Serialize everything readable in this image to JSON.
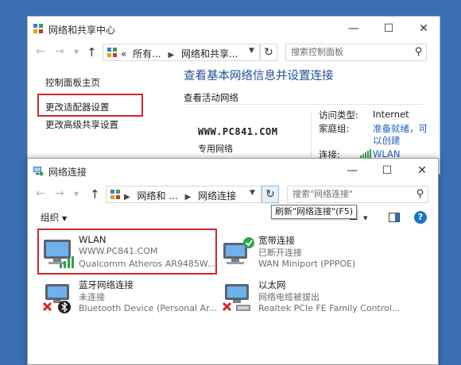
{
  "back_window": {
    "title": "网络和共享中心",
    "caption": {
      "minimize": "—",
      "maximize": "☐",
      "close": "✕"
    },
    "address": {
      "overflow": "«",
      "crumbs": [
        "所有...",
        "网络和共享..."
      ]
    },
    "search_placeholder": "搜索控制面板",
    "sidebar_links": [
      "控制面板主页",
      "更改适配器设置",
      "更改高级共享设置"
    ],
    "heading": "查看基本网络信息并设置连接",
    "active_networks_label": "查看活动网络",
    "network_name": "WWW.PC841.COM",
    "network_type": "专用网络",
    "access_type_label": "访问类型:",
    "access_type_value": "Internet",
    "homegroup_label": "家庭组:",
    "homegroup_value_line1": "准备就绪，可",
    "homegroup_value_line2": "以创建",
    "connections_label": "连接:",
    "connections_value": "WLAN"
  },
  "front_window": {
    "title": "网络连接",
    "caption": {
      "minimize": "—",
      "maximize": "☐",
      "close": "✕"
    },
    "address": {
      "crumbs": [
        "网络和 ...",
        "网络连接"
      ]
    },
    "search_placeholder": "搜索\"网络连接\"",
    "toolbar": {
      "organize": "组织",
      "help": "?"
    },
    "tooltip": "刷新\"网络连接\"(F5)",
    "items": [
      {
        "name": "WLAN",
        "status": "WWW.PC841.COM",
        "device": "Qualcomm Atheros AR9485W..."
      },
      {
        "name": "宽带连接",
        "status": "已断开连接",
        "device": "WAN Miniport (PPPOE)"
      },
      {
        "name": "蓝牙网络连接",
        "status": "未连接",
        "device": "Bluetooth Device (Personal Ar..."
      },
      {
        "name": "以太网",
        "status": "网络电缆被拔出",
        "device": "Realtek PCIe FE Family Control..."
      }
    ]
  },
  "colors": {
    "highlight_border": "#d42727",
    "link_blue": "#1f5fbf",
    "heading_blue": "#1f4e9b",
    "desktop": "#3b6fb4"
  },
  "icons": {
    "cp_icon": "control-panel-icon",
    "back": "arrow-left-icon",
    "forward": "arrow-right-icon",
    "up": "arrow-up-icon",
    "refresh": "refresh-icon",
    "search": "search-icon",
    "signal": "signal-bars-icon"
  }
}
